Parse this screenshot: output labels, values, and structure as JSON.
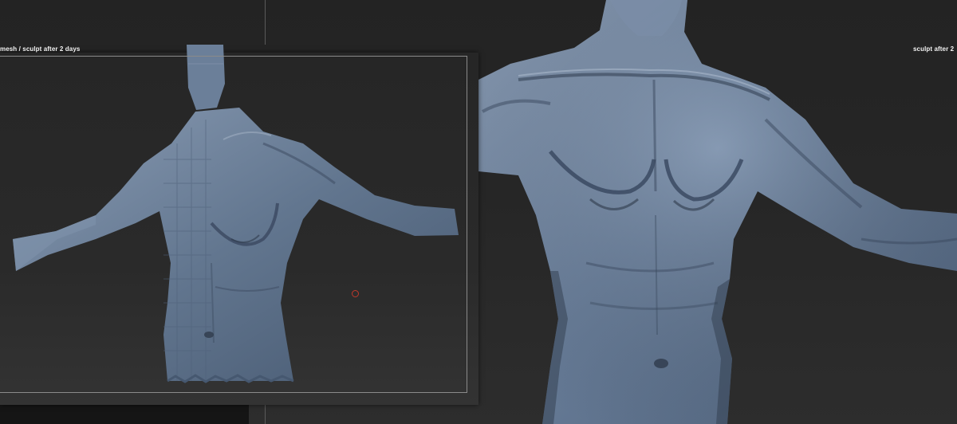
{
  "captions": {
    "left": "mesh / sculpt after 2 days",
    "right": "sculpt after 2"
  },
  "colors": {
    "background": "#1e1e1e",
    "model": "#5f7490",
    "model_highlight": "#8ea0b8",
    "model_shadow": "#2f3b4b",
    "frame": "#8a8a8a",
    "cursor": "#c0392b"
  }
}
